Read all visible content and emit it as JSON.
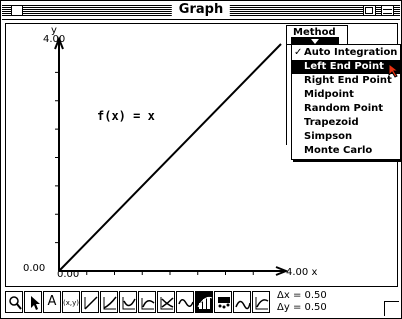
{
  "window": {
    "title": "Graph"
  },
  "graph": {
    "y_axis_label": "y",
    "y_max_label": "4.00",
    "y_min_label": "0.00",
    "x_min_label": "0.00",
    "x_max_label": "4.00",
    "x_axis_label": "x",
    "function_label": "f(x) = x"
  },
  "method": {
    "title": "Method",
    "items": [
      {
        "label": "Auto Integration",
        "checked": true
      },
      {
        "label": "Left End Point",
        "selected": true
      },
      {
        "label": "Right End Point"
      },
      {
        "label": "Midpoint"
      },
      {
        "label": "Random Point"
      },
      {
        "label": "Trapezoid"
      },
      {
        "label": "Simpson"
      },
      {
        "label": "Monte Carlo"
      }
    ],
    "check_glyph": "✓"
  },
  "toolbar": {
    "tools": [
      {
        "name": "zoom-tool",
        "icon": "magnifier-icon"
      },
      {
        "name": "pointer-tool",
        "icon": "arrow-icon"
      },
      {
        "name": "text-tool",
        "label": "A"
      },
      {
        "name": "coordinate-tool",
        "label": "(x,y)"
      },
      {
        "name": "tangent-tool",
        "icon": "tangent-icon"
      },
      {
        "name": "slope-tool",
        "icon": "slope-icon"
      },
      {
        "name": "derivative-tool",
        "icon": "derivative-icon"
      },
      {
        "name": "asymptote-tool",
        "icon": "asymptote-icon"
      },
      {
        "name": "intersection-tool",
        "icon": "intersection-icon"
      },
      {
        "name": "wave-tool",
        "icon": "wave-icon"
      },
      {
        "name": "integration-tool",
        "icon": "bars-icon",
        "pressed": true
      },
      {
        "name": "dot-tool",
        "icon": "dots-icon"
      },
      {
        "name": "curve-tool",
        "icon": "curve-icon"
      },
      {
        "name": "area-tool",
        "icon": "area-icon"
      }
    ],
    "delta_x": "Δx = 0.50",
    "delta_y": "Δy = 0.50"
  },
  "chart_data": {
    "type": "line",
    "x": [
      0,
      4
    ],
    "series": [
      {
        "values": [
          0,
          4
        ]
      }
    ],
    "xlim": [
      0,
      4
    ],
    "ylim": [
      0,
      4
    ],
    "x_ticks": [
      0.5,
      1,
      1.5,
      2,
      2.5,
      3,
      3.5
    ],
    "y_ticks": [
      0.5,
      1,
      1.5,
      2,
      2.5,
      3,
      3.5
    ]
  },
  "colors": {
    "foreground": "#000000",
    "background": "#ffffff"
  }
}
